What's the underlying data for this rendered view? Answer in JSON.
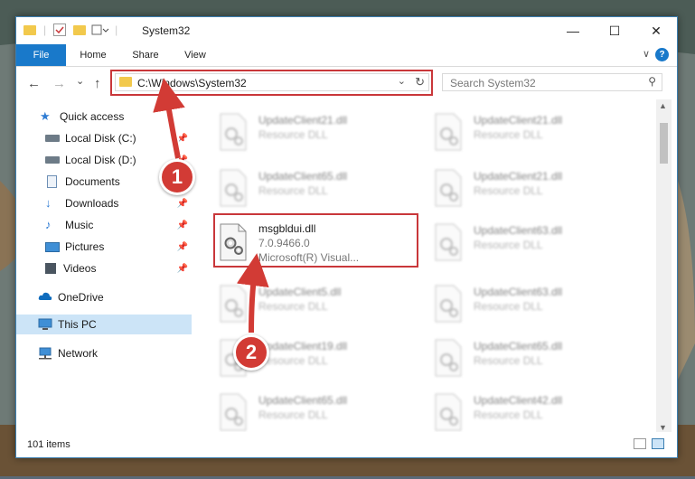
{
  "window": {
    "title": "System32",
    "minimize": "—",
    "maximize": "☐",
    "close": "✕"
  },
  "ribbon": {
    "tabs": [
      "File",
      "Home",
      "Share",
      "View"
    ],
    "help": "?",
    "collapse": "∨"
  },
  "address": {
    "path": "C:\\Windows\\System32",
    "search_placeholder": "Search System32"
  },
  "nav": {
    "back": "←",
    "forward": "→",
    "recent": "⌄",
    "up": "↑",
    "items": [
      {
        "label": "Quick access",
        "icon": "star-icon",
        "pinned": false
      },
      {
        "label": "Local Disk (C:)",
        "icon": "drive-icon",
        "pinned": true
      },
      {
        "label": "Local Disk (D:)",
        "icon": "drive-icon",
        "pinned": true
      },
      {
        "label": "Documents",
        "icon": "documents-icon",
        "pinned": true
      },
      {
        "label": "Downloads",
        "icon": "downloads-icon",
        "pinned": true
      },
      {
        "label": "Music",
        "icon": "music-icon",
        "pinned": true
      },
      {
        "label": "Pictures",
        "icon": "pictures-icon",
        "pinned": true
      },
      {
        "label": "Videos",
        "icon": "videos-icon",
        "pinned": true
      },
      {
        "label": "OneDrive",
        "icon": "onedrive-icon",
        "pinned": false
      },
      {
        "label": "This PC",
        "icon": "this-pc-icon",
        "pinned": false,
        "selected": true
      },
      {
        "label": "Network",
        "icon": "network-icon",
        "pinned": false
      }
    ]
  },
  "files": {
    "left": [
      {
        "name": "UpdateClient21.dll",
        "type": "Resource DLL"
      },
      {
        "name": "UpdateClient65.dll",
        "type": "Resource DLL"
      },
      {
        "name": "msgbldui.dll",
        "version": "7.0.9466.0",
        "company": "Microsoft(R) Visual..."
      },
      {
        "name": "UpdateClient5.dll",
        "type": "Resource DLL"
      },
      {
        "name": "UpdateClient19.dll",
        "type": "Resource DLL"
      },
      {
        "name": "UpdateClient65.dll",
        "type": "Resource DLL"
      }
    ],
    "right": [
      {
        "name": "UpdateClient21.dll",
        "type": "Resource DLL"
      },
      {
        "name": "UpdateClient21.dll",
        "type": "Resource DLL"
      },
      {
        "name": "UpdateClient63.dll",
        "type": "Resource DLL"
      },
      {
        "name": "UpdateClient63.dll",
        "type": "Resource DLL"
      },
      {
        "name": "UpdateClient65.dll",
        "type": "Resource DLL"
      },
      {
        "name": "UpdateClient42.dll",
        "type": "Resource DLL"
      }
    ]
  },
  "status": {
    "item_count": "101 items"
  },
  "annotations": {
    "step1": "1",
    "step2": "2",
    "color": "#d23b35"
  }
}
